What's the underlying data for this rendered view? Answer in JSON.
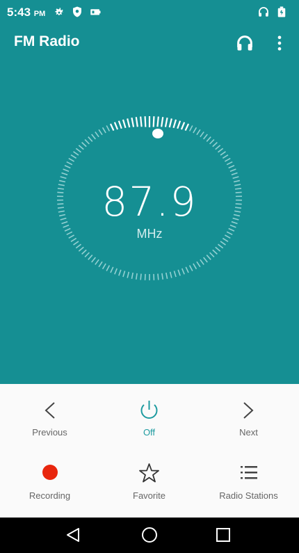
{
  "status": {
    "time": "5:43",
    "ampm": "PM",
    "icons": [
      "gear-icon",
      "shield-icon",
      "battery-saver-icon",
      "headphones-icon",
      "battery-icon"
    ]
  },
  "appbar": {
    "title": "FM Radio",
    "icons": [
      "headphones-icon",
      "more-vert-icon"
    ]
  },
  "tuner": {
    "frequency": "87.9",
    "unit": "MHz"
  },
  "controls": {
    "previous": "Previous",
    "power": "Off",
    "next": "Next",
    "recording": "Recording",
    "favorite": "Favorite",
    "stations": "Radio Stations"
  },
  "colors": {
    "primary": "#158f93",
    "accent_teal": "#1e9ba0",
    "record_red": "#e8260d",
    "panel_bg": "#fafafa"
  },
  "nav": {
    "icons": [
      "back-icon",
      "home-icon",
      "recents-icon"
    ]
  }
}
